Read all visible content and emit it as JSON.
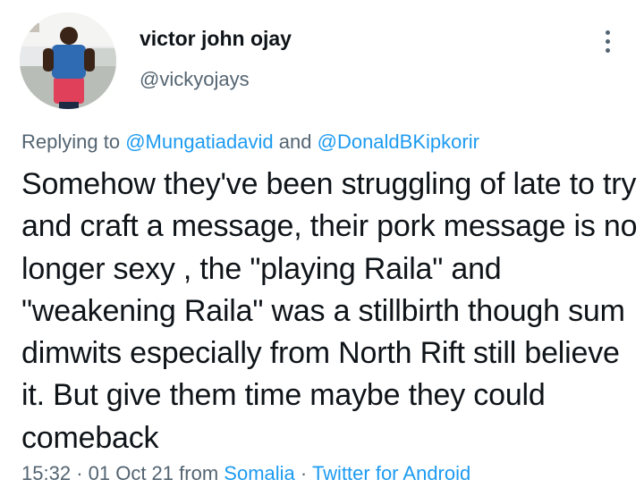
{
  "user": {
    "display_name": "victor john ojay",
    "handle": "@vickyojays"
  },
  "reply": {
    "prefix": "Replying to",
    "mention1": "@Mungatiadavid",
    "conjunction": "and",
    "mention2": "@DonaldBKipkorir"
  },
  "tweet": {
    "text": "Somehow they've been struggling of late to try and craft a message, their pork message is no longer sexy , the \"playing Raila\" and \"weakening Raila\" was a stillbirth though sum dimwits especially from North Rift still believe it. But give them time maybe they could comeback"
  },
  "meta": {
    "time": "15:32",
    "separator": "·",
    "date": "01 Oct 21",
    "from_label": "from",
    "location": "Somalia",
    "source": "Twitter for Android"
  },
  "icons": {
    "more": "more-options-icon",
    "avatar": "avatar"
  },
  "colors": {
    "text": "#0f1419",
    "secondary": "#536471",
    "link": "#1d9bf0"
  }
}
